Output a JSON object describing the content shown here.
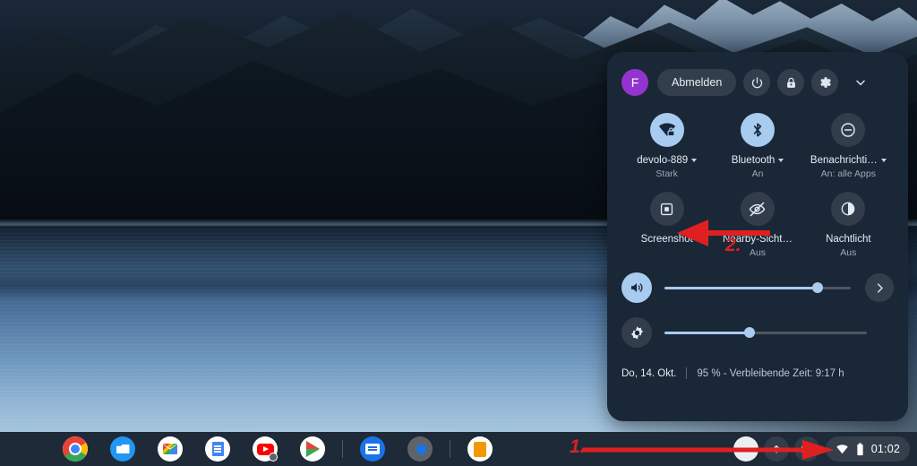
{
  "desktop": {
    "wallpaper_description": "Dark mountain lake at dusk with silvery water reflection",
    "colors": {
      "shelf": "#1f2a38",
      "panel": "#1a2736",
      "accent": "#a8cbf0",
      "annotation": "#e02020"
    }
  },
  "quick_settings": {
    "avatar_initial": "F",
    "sign_out_label": "Abmelden",
    "header_buttons": [
      {
        "name": "power-button",
        "icon": "power-icon"
      },
      {
        "name": "lock-button",
        "icon": "lock-icon"
      },
      {
        "name": "settings-button",
        "icon": "gear-icon"
      },
      {
        "name": "collapse-button",
        "icon": "chevron-down-icon"
      }
    ],
    "tiles": [
      {
        "icon": "wifi-locked-icon",
        "label": "devolo-889",
        "sub": "Stark",
        "state": "on",
        "has_caret": true
      },
      {
        "icon": "bluetooth-icon",
        "label": "Bluetooth",
        "sub": "An",
        "state": "on",
        "has_caret": true
      },
      {
        "icon": "do-not-disturb-icon",
        "label": "Benachrichti…",
        "sub": "An: alle Apps",
        "state": "off",
        "has_caret": true
      },
      {
        "icon": "screenshot-icon",
        "label": "Screenshot",
        "sub": "",
        "state": "off",
        "has_caret": false
      },
      {
        "icon": "eye-slash-icon",
        "label": "Nearby-Sicht…",
        "sub": "Aus",
        "state": "off",
        "has_caret": false
      },
      {
        "icon": "night-light-icon",
        "label": "Nachtlicht",
        "sub": "Aus",
        "state": "off",
        "has_caret": false
      }
    ],
    "sliders": [
      {
        "name": "volume-slider",
        "icon": "volume-icon",
        "value": 82
      },
      {
        "name": "brightness-slider",
        "icon": "brightness-icon",
        "value": 42
      }
    ],
    "audio_next_label": "›",
    "footer": {
      "date": "Do, 14. Okt.",
      "battery": "95 % - Verbleibende Zeit: 9:17 h"
    }
  },
  "shelf": {
    "apps": [
      {
        "name": "chrome",
        "class": "ic-chrome"
      },
      {
        "name": "files",
        "class": "ic-files"
      },
      {
        "name": "gmail",
        "class": "ic-gmail"
      },
      {
        "name": "docs",
        "class": "ic-docs"
      },
      {
        "name": "youtube",
        "class": "ic-yt"
      },
      {
        "name": "play-store",
        "class": "ic-play"
      },
      {
        "name": "messages",
        "class": "ic-chat"
      },
      {
        "name": "settings",
        "class": "ic-settings"
      },
      {
        "name": "pdf-viewer",
        "class": "ic-orange"
      }
    ],
    "tray": {
      "time": "01:02",
      "wifi_icon": "wifi-icon",
      "battery_icon": "battery-icon"
    }
  },
  "annotations": [
    {
      "id": "1",
      "label": "1.",
      "target": "system-tray"
    },
    {
      "id": "2",
      "label": "2.",
      "target": "screenshot-tile"
    }
  ]
}
